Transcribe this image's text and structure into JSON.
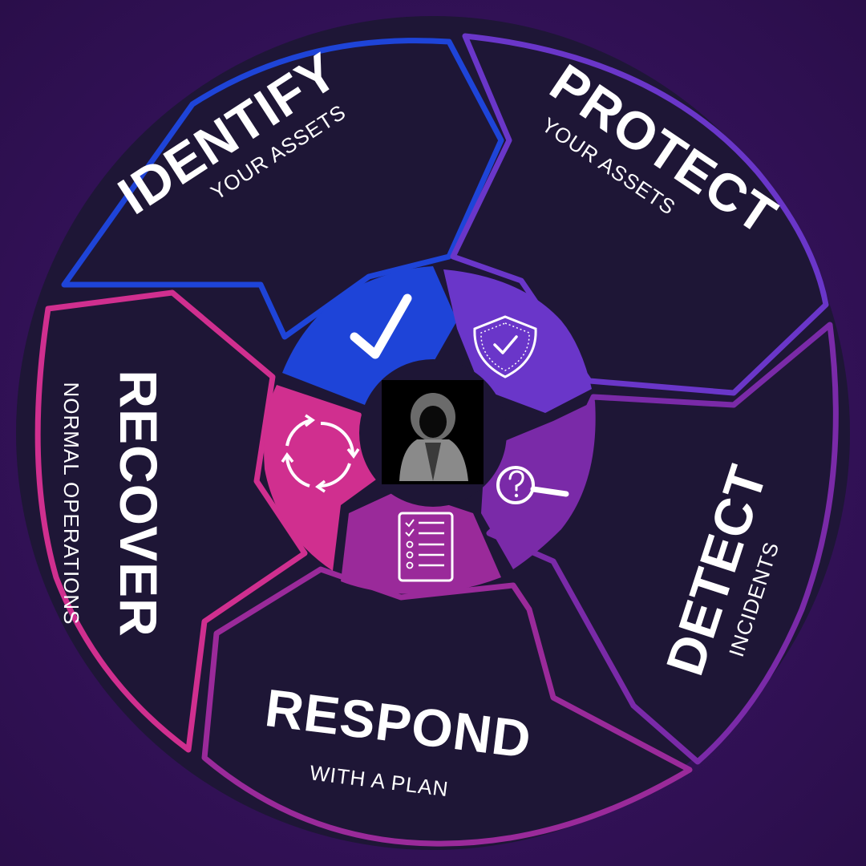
{
  "colors": {
    "background": "#3a1560",
    "panel": "#1e1636",
    "identify": "#1e44d8",
    "protect": "#6a36c9",
    "detect": "#7a2aa8",
    "respond": "#9a2a9a",
    "recover": "#d02f8f"
  },
  "segments": [
    {
      "id": "identify",
      "title": "IDENTIFY",
      "subtitle": "YOUR ASSETS",
      "icon": "checkmark-icon"
    },
    {
      "id": "protect",
      "title": "PROTECT",
      "subtitle": "YOUR ASSETS",
      "icon": "shield-check-icon"
    },
    {
      "id": "detect",
      "title": "DETECT",
      "subtitle": "INCIDENTS",
      "icon": "magnifier-question-icon"
    },
    {
      "id": "respond",
      "title": "RESPOND",
      "subtitle": "WITH A PLAN",
      "icon": "checklist-icon"
    },
    {
      "id": "recover",
      "title": "RECOVER",
      "subtitle": "NORMAL OPERATIONS",
      "icon": "cycle-arrows-icon"
    }
  ],
  "center": {
    "icon": "hooded-figure-icon"
  }
}
